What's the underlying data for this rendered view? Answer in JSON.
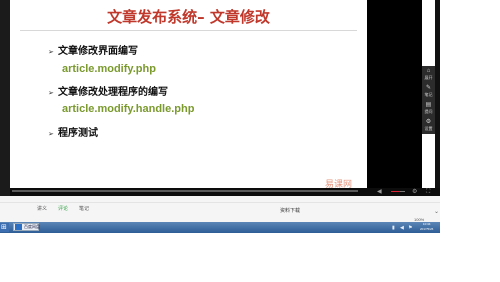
{
  "slide": {
    "title": "文章发布系统– 文章修改",
    "bullets": [
      {
        "text": "文章修改界面编写",
        "code": "article.modify.php"
      },
      {
        "text": "文章修改处理程序的编写",
        "code": "article.modify.handle.php"
      },
      {
        "text": "程序测试",
        "code": ""
      }
    ],
    "bullet_mark": "➢",
    "watermark": "易课网"
  },
  "side_panel": [
    {
      "icon": "⌂",
      "label": "展开"
    },
    {
      "icon": "✎",
      "label": "笔记"
    },
    {
      "icon": "▤",
      "label": "提问"
    },
    {
      "icon": "⚙",
      "label": "设置"
    }
  ],
  "player": {
    "play_icon": "◀",
    "volume_icon": "◀",
    "settings_icon": "⚙",
    "fullscreen_icon": "⛶",
    "volume_level": 0.64
  },
  "tabs": [
    "讲义",
    "评论",
    "笔记"
  ],
  "download_label": "资料下载",
  "zoom_label": "100%",
  "taskbar": {
    "start_icon": "⊞",
    "app_label": "百度网盘",
    "time": "10:34",
    "date": "2017/5/26"
  },
  "colors": {
    "title": "#c0382b",
    "code": "#7a9a2d",
    "active_tab": "#3aa54c",
    "taskbar": "#2e5c95"
  }
}
